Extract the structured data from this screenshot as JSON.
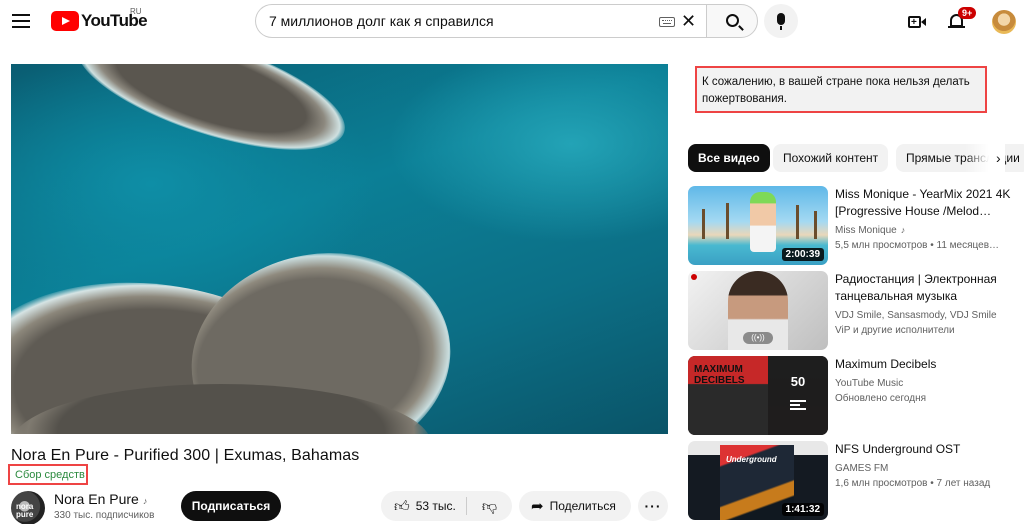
{
  "header": {
    "logo_text": "YouTube",
    "region": "RU",
    "search_query": "7 миллионов долг как я справился",
    "notifications_count": "9+"
  },
  "video": {
    "title": "Nora En Pure - Purified 300 | Exumas, Bahamas",
    "fundraiser_label": "Сбор средств",
    "channel_name": "Nora En Pure",
    "subscribers": "330 тыс. подписчиков",
    "subscribe_label": "Подписаться",
    "likes": "53 тыс.",
    "share_label": "Поделиться",
    "more_label": "···"
  },
  "sidebar": {
    "donation_notice": "К сожалению, в вашей стране пока нельзя делать пожертвования.",
    "chips": [
      "Все видео",
      "Похожий контент",
      "Прямые трансляции"
    ],
    "recommendations": [
      {
        "title": "Miss Monique - YearMix 2021 4K [Progressive House /Melod…",
        "channel": "Miss Monique",
        "meta": "5,5 млн просмотров • 11 месяцев…",
        "duration": "2:00:39"
      },
      {
        "title": "Радиостанция | Электронная танцевальная музыка",
        "channel": "VDJ Smile, Sansasmody, VDJ Smile",
        "meta": "ViP и другие исполнители",
        "live_icon": "((•))"
      },
      {
        "title": "Maximum Decibels",
        "channel": "YouTube Music",
        "meta": "Обновлено сегодня",
        "count": "50",
        "art_text": "MAXIMUM DECIBELS"
      },
      {
        "title": "NFS Underground OST",
        "channel": "GAMES FM",
        "meta": "1,6 млн просмотров • 7 лет назад",
        "duration": "1:41:32",
        "art_text": "Underground"
      }
    ]
  },
  "colors": {
    "brand_red": "#ff0000",
    "highlight_border": "#e44444",
    "fundraiser_green": "#2b8a3e"
  }
}
